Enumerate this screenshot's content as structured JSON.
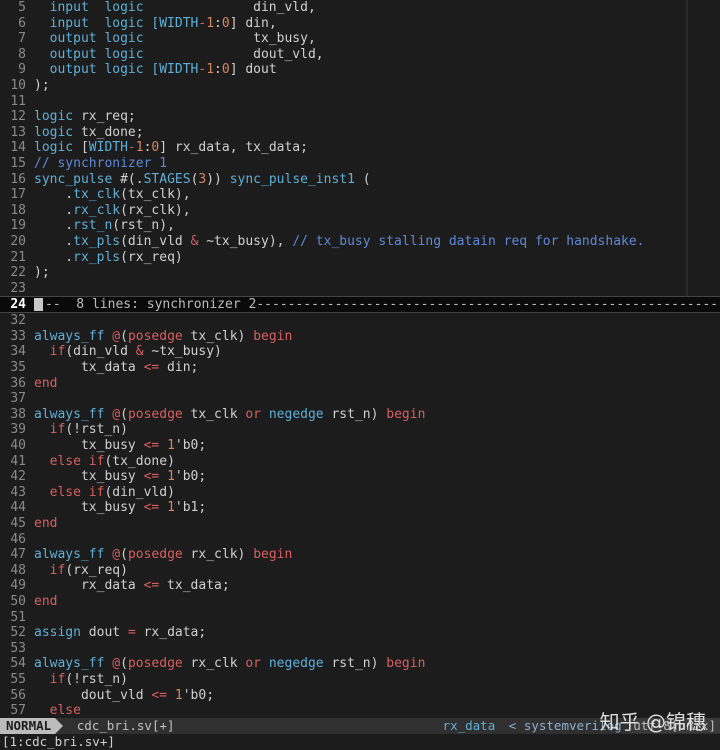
{
  "colors": {
    "keyword": "#5fafd7",
    "operator": "#d75f5f",
    "number": "#d7875f",
    "comment": "#5f87d7",
    "string_port": "#5fafd7"
  },
  "lines": [
    {
      "n": "5",
      "code": [
        [
          "kw",
          "  input  logic"
        ],
        [
          "",
          "              din_vld,"
        ]
      ]
    },
    {
      "n": "6",
      "code": [
        [
          "kw",
          "  input  logic"
        ],
        [
          "",
          ""
        ],
        [
          "kw",
          " ["
        ],
        [
          "kw",
          "WIDTH"
        ],
        [
          "op",
          "-"
        ],
        [
          "num",
          "1"
        ],
        [
          "",
          ":"
        ],
        [
          "num",
          "0"
        ],
        [
          "",
          "] din,"
        ]
      ]
    },
    {
      "n": "7",
      "code": [
        [
          "kw",
          "  output logic"
        ],
        [
          "",
          "              tx_busy,"
        ]
      ]
    },
    {
      "n": "8",
      "code": [
        [
          "kw",
          "  output logic"
        ],
        [
          "",
          "              dout_vld,"
        ]
      ]
    },
    {
      "n": "9",
      "code": [
        [
          "kw",
          "  output logic"
        ],
        [
          "kw",
          " ["
        ],
        [
          "kw",
          "WIDTH"
        ],
        [
          "op",
          "-"
        ],
        [
          "num",
          "1"
        ],
        [
          "",
          ":"
        ],
        [
          "num",
          "0"
        ],
        [
          "",
          "] dout"
        ]
      ]
    },
    {
      "n": "10",
      "code": [
        [
          "",
          ");"
        ]
      ]
    },
    {
      "n": "11",
      "code": [
        [
          "",
          ""
        ]
      ]
    },
    {
      "n": "12",
      "code": [
        [
          "kw",
          "logic"
        ],
        [
          "",
          " rx_req;"
        ]
      ]
    },
    {
      "n": "13",
      "code": [
        [
          "kw",
          "logic"
        ],
        [
          "",
          " tx_done;"
        ]
      ]
    },
    {
      "n": "14",
      "code": [
        [
          "kw",
          "logic"
        ],
        [
          "",
          " ["
        ],
        [
          "kw",
          "WIDTH"
        ],
        [
          "op",
          "-"
        ],
        [
          "num",
          "1"
        ],
        [
          "",
          ":"
        ],
        [
          "num",
          "0"
        ],
        [
          "",
          "] rx_data, tx_data;"
        ]
      ]
    },
    {
      "n": "15",
      "code": [
        [
          "cm",
          "// synchronizer 1"
        ]
      ]
    },
    {
      "n": "16",
      "code": [
        [
          "kw",
          "sync_pulse"
        ],
        [
          "",
          " #(."
        ],
        [
          "kw",
          "STAGES"
        ],
        [
          "",
          "("
        ],
        [
          "num",
          "3"
        ],
        [
          "",
          "))"
        ],
        [
          "kw",
          " sync_pulse_inst1"
        ],
        [
          "",
          " ("
        ]
      ]
    },
    {
      "n": "17",
      "code": [
        [
          "",
          "    ."
        ],
        [
          "kw",
          "tx_clk"
        ],
        [
          "",
          "(tx_clk),"
        ]
      ]
    },
    {
      "n": "18",
      "code": [
        [
          "",
          "    ."
        ],
        [
          "kw",
          "rx_clk"
        ],
        [
          "",
          "(rx_clk),"
        ]
      ]
    },
    {
      "n": "19",
      "code": [
        [
          "",
          "    ."
        ],
        [
          "kw",
          "rst_n"
        ],
        [
          "",
          "(rst_n),"
        ]
      ]
    },
    {
      "n": "20",
      "code": [
        [
          "",
          "    ."
        ],
        [
          "kw",
          "tx_pls"
        ],
        [
          "",
          "(din_vld "
        ],
        [
          "op",
          "&"
        ],
        [
          "",
          " ~tx_busy), "
        ],
        [
          "cm",
          "// tx_busy stalling datain req for handshake."
        ]
      ]
    },
    {
      "n": "21",
      "code": [
        [
          "",
          "    ."
        ],
        [
          "kw",
          "rx_pls"
        ],
        [
          "",
          "(rx_req)"
        ]
      ]
    },
    {
      "n": "22",
      "code": [
        [
          "",
          ");"
        ]
      ]
    },
    {
      "n": "23",
      "code": [
        [
          "",
          ""
        ]
      ]
    },
    {
      "n": "24",
      "fold": "--  8 lines: synchronizer 2------------------------------------------------------------"
    },
    {
      "n": "32",
      "code": [
        [
          "",
          ""
        ]
      ]
    },
    {
      "n": "33",
      "code": [
        [
          "kw",
          "always_ff"
        ],
        [
          "",
          " "
        ],
        [
          "op",
          "@"
        ],
        [
          "",
          "("
        ],
        [
          "op",
          "posedge"
        ],
        [
          "",
          " tx_clk) "
        ],
        [
          "op",
          "begin"
        ]
      ]
    },
    {
      "n": "34",
      "code": [
        [
          "op",
          "  if"
        ],
        [
          "",
          "(din_vld "
        ],
        [
          "op",
          "&"
        ],
        [
          "",
          " ~tx_busy)"
        ]
      ]
    },
    {
      "n": "35",
      "code": [
        [
          "",
          "      tx_data "
        ],
        [
          "op",
          "<="
        ],
        [
          "",
          " din;"
        ]
      ]
    },
    {
      "n": "36",
      "code": [
        [
          "op",
          "end"
        ]
      ]
    },
    {
      "n": "37",
      "code": [
        [
          "",
          ""
        ]
      ]
    },
    {
      "n": "38",
      "code": [
        [
          "kw",
          "always_ff"
        ],
        [
          "",
          " "
        ],
        [
          "op",
          "@"
        ],
        [
          "",
          "("
        ],
        [
          "op",
          "posedge"
        ],
        [
          "",
          " tx_clk "
        ],
        [
          "op",
          "or"
        ],
        [
          "",
          " "
        ],
        [
          "kw",
          "negedge"
        ],
        [
          "",
          " rst_n) "
        ],
        [
          "op",
          "begin"
        ]
      ]
    },
    {
      "n": "39",
      "code": [
        [
          "op",
          "  if"
        ],
        [
          "",
          "(!rst_n)"
        ]
      ]
    },
    {
      "n": "40",
      "code": [
        [
          "",
          "      tx_busy "
        ],
        [
          "op",
          "<="
        ],
        [
          "",
          " "
        ],
        [
          "num",
          "1"
        ],
        [
          "",
          "'b0;"
        ]
      ]
    },
    {
      "n": "41",
      "code": [
        [
          "op",
          "  else if"
        ],
        [
          "",
          "(tx_done)"
        ]
      ]
    },
    {
      "n": "42",
      "code": [
        [
          "",
          "      tx_busy "
        ],
        [
          "op",
          "<="
        ],
        [
          "",
          " "
        ],
        [
          "num",
          "1"
        ],
        [
          "",
          "'b0;"
        ]
      ]
    },
    {
      "n": "43",
      "code": [
        [
          "op",
          "  else if"
        ],
        [
          "",
          "(din_vld)"
        ]
      ]
    },
    {
      "n": "44",
      "code": [
        [
          "",
          "      tx_busy "
        ],
        [
          "op",
          "<="
        ],
        [
          "",
          " "
        ],
        [
          "num",
          "1"
        ],
        [
          "",
          "'b1;"
        ]
      ]
    },
    {
      "n": "45",
      "code": [
        [
          "op",
          "end"
        ]
      ]
    },
    {
      "n": "46",
      "code": [
        [
          "",
          ""
        ]
      ]
    },
    {
      "n": "47",
      "code": [
        [
          "kw",
          "always_ff"
        ],
        [
          "",
          " "
        ],
        [
          "op",
          "@"
        ],
        [
          "",
          "("
        ],
        [
          "op",
          "posedge"
        ],
        [
          "",
          " rx_clk) "
        ],
        [
          "op",
          "begin"
        ]
      ]
    },
    {
      "n": "48",
      "code": [
        [
          "op",
          "  if"
        ],
        [
          "",
          "(rx_req)"
        ]
      ]
    },
    {
      "n": "49",
      "code": [
        [
          "",
          "      rx_data "
        ],
        [
          "op",
          "<="
        ],
        [
          "",
          " tx_data;"
        ]
      ]
    },
    {
      "n": "50",
      "code": [
        [
          "op",
          "end"
        ]
      ]
    },
    {
      "n": "51",
      "code": [
        [
          "",
          ""
        ]
      ]
    },
    {
      "n": "52",
      "code": [
        [
          "kw",
          "assign"
        ],
        [
          "",
          " dout "
        ],
        [
          "op",
          "="
        ],
        [
          "",
          " rx_data;"
        ]
      ]
    },
    {
      "n": "53",
      "code": [
        [
          "",
          ""
        ]
      ]
    },
    {
      "n": "54",
      "code": [
        [
          "kw",
          "always_ff"
        ],
        [
          "",
          " "
        ],
        [
          "op",
          "@"
        ],
        [
          "",
          "("
        ],
        [
          "op",
          "posedge"
        ],
        [
          "",
          " rx_clk "
        ],
        [
          "op",
          "or"
        ],
        [
          "",
          " "
        ],
        [
          "kw",
          "negedge"
        ],
        [
          "",
          " rst_n) "
        ],
        [
          "op",
          "begin"
        ]
      ]
    },
    {
      "n": "55",
      "code": [
        [
          "op",
          "  if"
        ],
        [
          "",
          "(!rst_n)"
        ]
      ]
    },
    {
      "n": "56",
      "code": [
        [
          "",
          "      dout_vld "
        ],
        [
          "op",
          "<="
        ],
        [
          "",
          " "
        ],
        [
          "num",
          "1"
        ],
        [
          "",
          "'b0;"
        ]
      ]
    },
    {
      "n": "57",
      "code": [
        [
          "op",
          "  else"
        ]
      ]
    }
  ],
  "statusline": {
    "mode": "NORMAL",
    "filename": "cdc_bri.sv[+]",
    "function": "rx_data",
    "filetype": "systemverilog",
    "encoding": "utf-8[unix]"
  },
  "cmdline": "[1:cdc_bri.sv+]",
  "watermark": "知乎 @锦穗"
}
